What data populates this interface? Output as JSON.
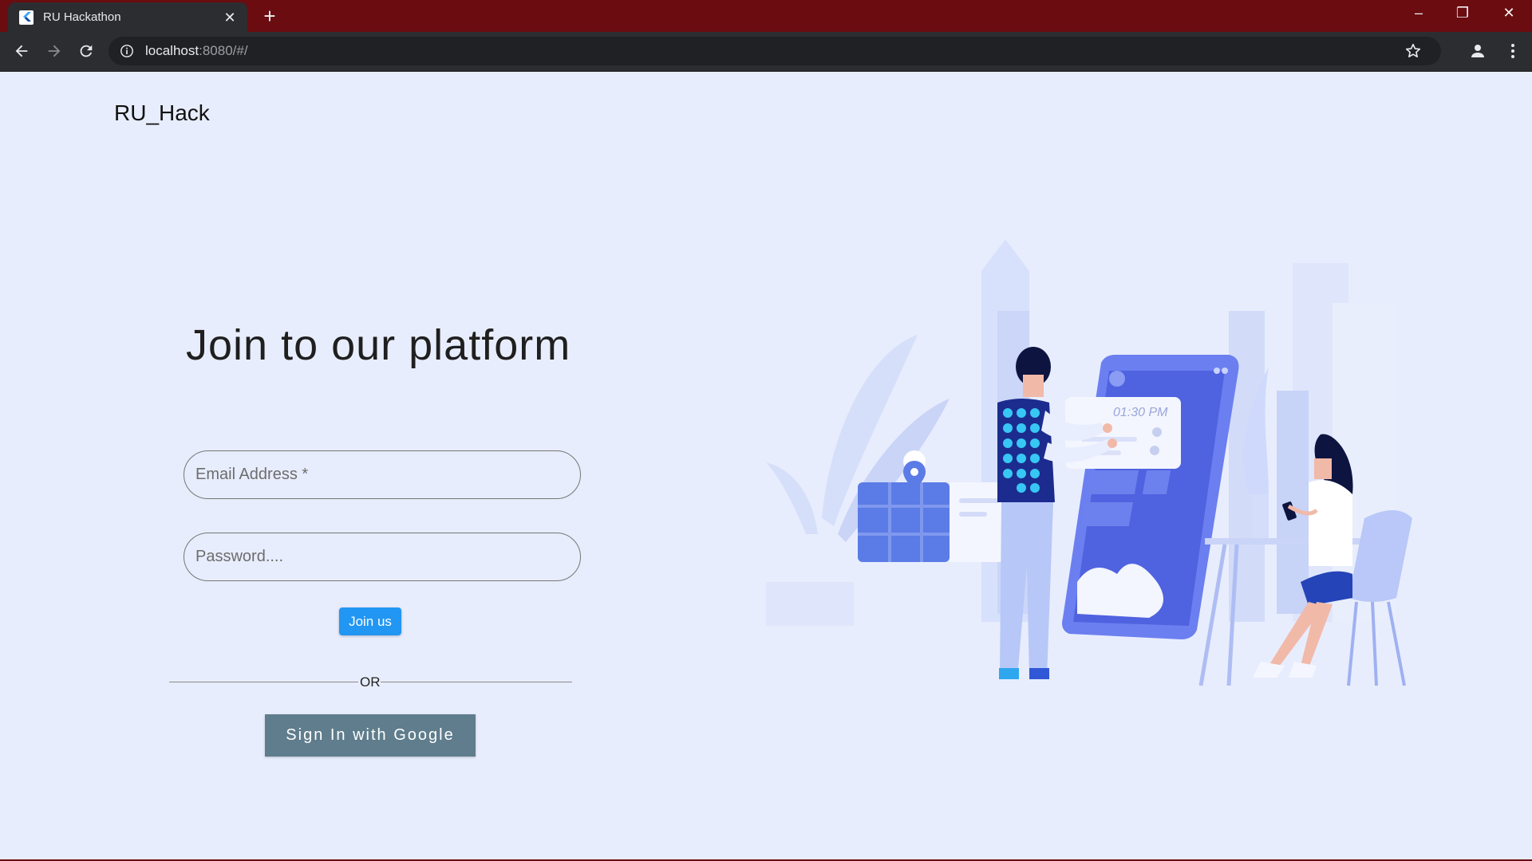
{
  "browser": {
    "tab_title": "RU Hackathon",
    "tab_close": "✕",
    "new_tab": "+",
    "url_host": "localhost",
    "url_rest": ":8080/#/",
    "window_controls": {
      "minimize": "–",
      "maximize": "❐",
      "close": "✕"
    }
  },
  "page": {
    "brand": "RU_Hack",
    "headline": "Join to our platform",
    "email_placeholder": "Email Address *",
    "password_placeholder": "Password....",
    "join_button": "Join us",
    "divider_text": "OR",
    "google_button": "Sign In with Google",
    "illustration_time": "01:30 PM"
  },
  "colors": {
    "titlebar": "#6a0c10",
    "page_background": "#e8edfd",
    "join_button": "#2196f3",
    "google_button": "#5f7d8c"
  }
}
